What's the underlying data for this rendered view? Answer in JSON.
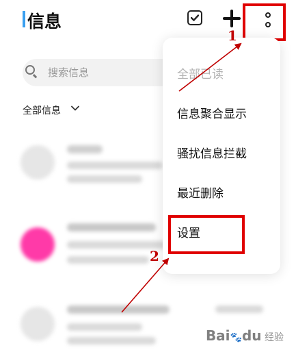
{
  "header": {
    "title": "信息"
  },
  "search": {
    "placeholder": "搜索信息"
  },
  "filter": {
    "label": "全部信息"
  },
  "menu": {
    "items": [
      {
        "label": "全部已读",
        "disabled": true
      },
      {
        "label": "信息聚合显示",
        "disabled": false
      },
      {
        "label": "骚扰信息拦截",
        "disabled": false
      },
      {
        "label": "最近删除",
        "disabled": false
      },
      {
        "label": "设置",
        "disabled": false
      }
    ]
  },
  "annotations": {
    "step1": "1",
    "step2": "2",
    "color": "#c00000"
  },
  "watermark": {
    "brand": "Bai",
    "paw": "du",
    "suffix": "经验"
  },
  "colors": {
    "accent": "#3aa0f0",
    "highlight_red": "#e00000",
    "avatar_pink": "#ff3aa8"
  }
}
